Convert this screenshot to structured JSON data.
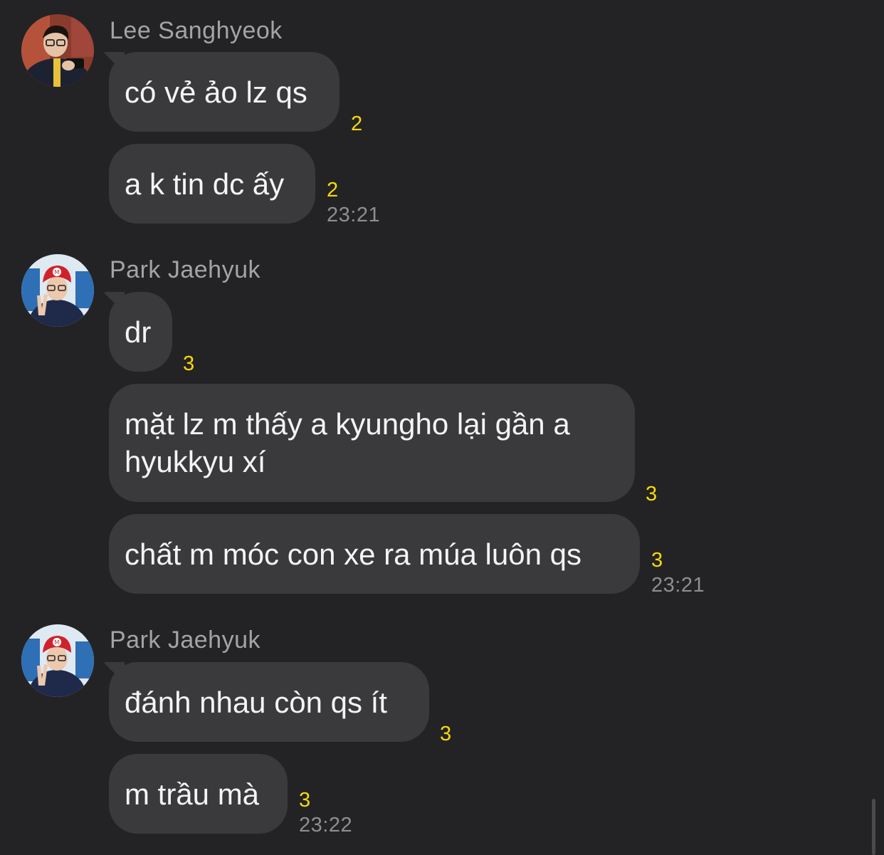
{
  "groups": [
    {
      "sender": "Lee Sanghyeok",
      "avatar": "avatar-lee-sanghyeok",
      "messages": [
        {
          "text": "có vẻ ảo lz qs",
          "unread": "2"
        },
        {
          "text": "a k tin dc ấy",
          "unread": "2",
          "time": "23:21"
        }
      ]
    },
    {
      "sender": "Park Jaehyuk",
      "avatar": "avatar-park-jaehyuk",
      "messages": [
        {
          "text": "dr",
          "unread": "3"
        },
        {
          "text": "mặt lz m thấy a kyungho lại gần a hyukkyu xí",
          "unread": "3"
        },
        {
          "text": "chất m móc con xe ra múa luôn qs",
          "unread": "3",
          "time": "23:21"
        }
      ]
    },
    {
      "sender": "Park Jaehyuk",
      "avatar": "avatar-park-jaehyuk",
      "messages": [
        {
          "text": "đánh nhau còn qs ít",
          "unread": "3"
        },
        {
          "text": "m trầu mà",
          "unread": "3",
          "time": "23:22"
        }
      ]
    }
  ],
  "colors": {
    "background": "#232325",
    "bubble": "#3a3a3c",
    "sender": "#a3a3a8",
    "unread": "#f5d90a",
    "time": "#8e8e93"
  }
}
